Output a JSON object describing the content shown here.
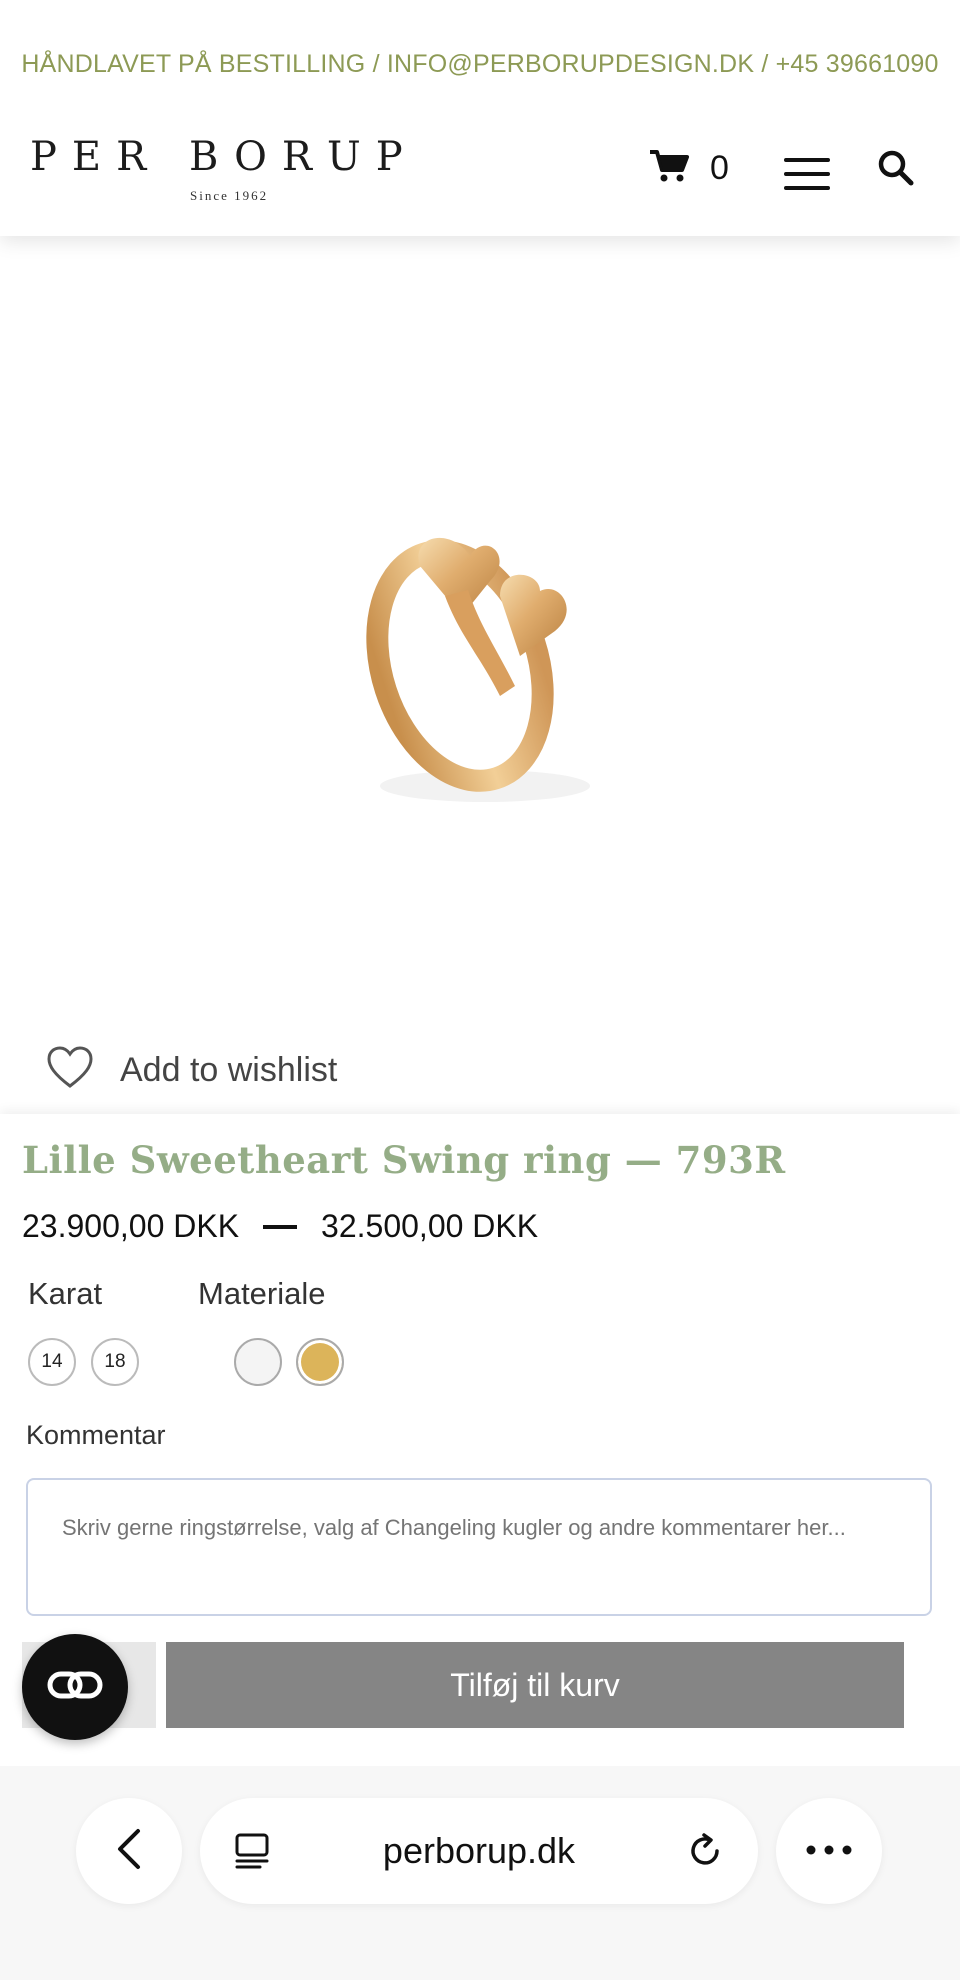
{
  "header": {
    "announcement": "HÅNDLAVET PÅ BESTILLING / INFO@PERBORUPDESIGN.DK / +45 39661090",
    "logo_main": "PER BORUP",
    "logo_sub": "Since 1962",
    "cart_count": "0",
    "accent_color": "#8d9a55"
  },
  "icons": {
    "cart": "cart-icon",
    "menu": "hamburger-menu-icon",
    "search": "search-icon",
    "wishlist": "heart-icon",
    "chat": "chat-icon",
    "back": "chevron-left-icon",
    "tabs": "tabs-icon",
    "reload": "reload-icon",
    "more": "more-icon"
  },
  "product": {
    "wishlist_label": "Add to wishlist",
    "title": "Lille Sweetheart Swing ring — 793R",
    "price_min": "23.900,00 DKK",
    "price_max": "32.500,00 DKK",
    "title_color": "#95ad87"
  },
  "options": {
    "karat_label": "Karat",
    "karat_values": [
      "14",
      "18"
    ],
    "material_label": "Materiale",
    "material_colors": [
      "#f4f4f4",
      "#dcb45a"
    ],
    "material_selected": "#dcb45a"
  },
  "comment": {
    "label": "Kommentar",
    "placeholder": "Skriv gerne ringstørrelse, valg af Changeling kugler og andre kommentarer her..."
  },
  "cart_button": {
    "label": "Tilføj til kurv",
    "color": "#858585"
  },
  "browser": {
    "url": "perborup.dk"
  }
}
